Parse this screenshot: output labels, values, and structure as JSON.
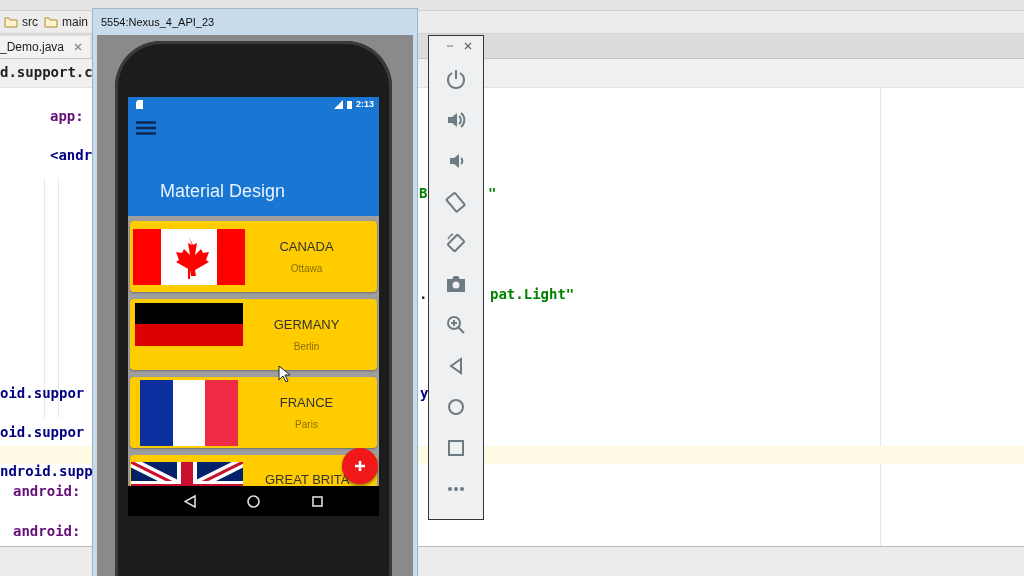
{
  "ide": {
    "breadcrumbs": [
      "src",
      "main"
    ],
    "tab": {
      "label": "_Demo.java"
    },
    "code": [
      {
        "text": "d.support.c",
        "kind": "plain"
      },
      {
        "text": "app:",
        "kind": "attr"
      },
      {
        "text": "<andr",
        "kind": "tag"
      },
      {
        "text": "B",
        "kind": "string"
      },
      {
        "text": "\"",
        "kind": "string"
      },
      {
        "text": ".",
        "kind": "plain"
      },
      {
        "text": "pat.Light\"",
        "kind": "string"
      },
      {
        "text": "oid.suppor",
        "kind": "tag"
      },
      {
        "text": "y",
        "kind": "tag"
      },
      {
        "text": "oid.suppor",
        "kind": "tag"
      },
      {
        "text": "ndroid.supp",
        "kind": "tag"
      },
      {
        "text": "android:",
        "kind": "attr"
      },
      {
        "text": "android:",
        "kind": "attr"
      }
    ]
  },
  "emulator": {
    "title": "5554:Nexus_4_API_23",
    "status_bar": {
      "time": "2:13"
    },
    "app_bar": {
      "title": "Material Design"
    },
    "countries": [
      {
        "name": "CANADA",
        "capital": "Ottawa",
        "kind": "canada"
      },
      {
        "name": "GERMANY",
        "capital": "Berlin",
        "kind": "germany"
      },
      {
        "name": "FRANCE",
        "capital": "Paris",
        "kind": "france"
      },
      {
        "name": "GREAT BRITA",
        "kind": "uk"
      }
    ]
  },
  "controls": [
    {
      "kind": "power"
    },
    {
      "kind": "volume_up"
    },
    {
      "kind": "volume_down"
    },
    {
      "kind": "rotate_left"
    },
    {
      "kind": "rotate_right"
    },
    {
      "kind": "camera"
    },
    {
      "kind": "zoom"
    },
    {
      "kind": "back"
    },
    {
      "kind": "home"
    },
    {
      "kind": "overview"
    },
    {
      "kind": "more"
    }
  ]
}
